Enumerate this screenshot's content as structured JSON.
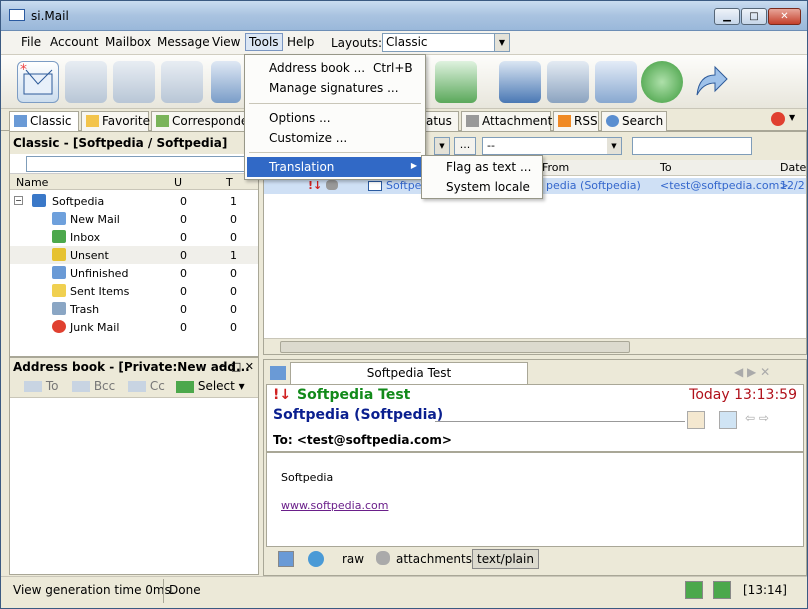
{
  "window": {
    "title": "si.Mail"
  },
  "menu": {
    "items": [
      "File",
      "Account",
      "Mailbox",
      "Message",
      "View",
      "Tools",
      "Help"
    ],
    "layouts_label": "Layouts:",
    "layouts_value": "Classic"
  },
  "tabs": [
    "Classic",
    "Favorite",
    "Corresponde",
    "atus",
    "Attachment",
    "RSS",
    "Search"
  ],
  "left_panel": {
    "header": "Classic - [Softpedia / Softpedia]",
    "columns": {
      "name": "Name",
      "u": "U",
      "t": "T"
    },
    "folders": [
      {
        "name": "Softpedia",
        "u": "0",
        "t": "1",
        "icon": "account-icon"
      },
      {
        "name": "New Mail",
        "u": "0",
        "t": "0",
        "icon": "new-mail-icon"
      },
      {
        "name": "Inbox",
        "u": "0",
        "t": "0",
        "icon": "inbox-icon"
      },
      {
        "name": "Unsent",
        "u": "0",
        "t": "1",
        "icon": "unsent-icon"
      },
      {
        "name": "Unfinished",
        "u": "0",
        "t": "0",
        "icon": "unfinished-icon"
      },
      {
        "name": "Sent Items",
        "u": "0",
        "t": "0",
        "icon": "sent-icon"
      },
      {
        "name": "Trash",
        "u": "0",
        "t": "0",
        "icon": "trash-icon"
      },
      {
        "name": "Junk Mail",
        "u": "0",
        "t": "0",
        "icon": "junk-icon"
      }
    ]
  },
  "address_book": {
    "header": "Address book - [Private:New add...",
    "to": "To",
    "bcc": "Bcc",
    "cc": "Cc",
    "select": "Select"
  },
  "message_list": {
    "filter_value": "--",
    "filter_button": "...",
    "columns": {
      "from": "From",
      "to": "To",
      "date": "Date"
    },
    "row": {
      "subject": "Softpe",
      "from": "pedia (Softpedia)",
      "to": "<test@softpedia.com>",
      "date": "12/2"
    }
  },
  "preview": {
    "tab": "Softpedia Test",
    "subject": "Softpedia Test",
    "time": "Today 13:13:59",
    "from": "Softpedia (Softpedia)",
    "to": "To: <test@softpedia.com>",
    "body_text": "Softpedia",
    "body_link": "www.softpedia.com",
    "footer": {
      "raw": "raw",
      "attachments": "attachments",
      "plain": "text/plain"
    }
  },
  "tools_menu": {
    "address_book": "Address book ...",
    "address_book_shortcut": "Ctrl+B",
    "manage_signatures": "Manage signatures ...",
    "options": "Options ...",
    "customize": "Customize ...",
    "translation": "Translation"
  },
  "translation_submenu": {
    "flag_as_text": "Flag as text ...",
    "system_locale": "System locale"
  },
  "status": {
    "left": "View generation time 0ms.",
    "done": "Done",
    "clock": "[13:14]"
  },
  "colors": {
    "accent": "#3169c6",
    "subject_green": "#128a1a",
    "from_navy": "#0a1f8f",
    "time_red": "#b0101a"
  }
}
